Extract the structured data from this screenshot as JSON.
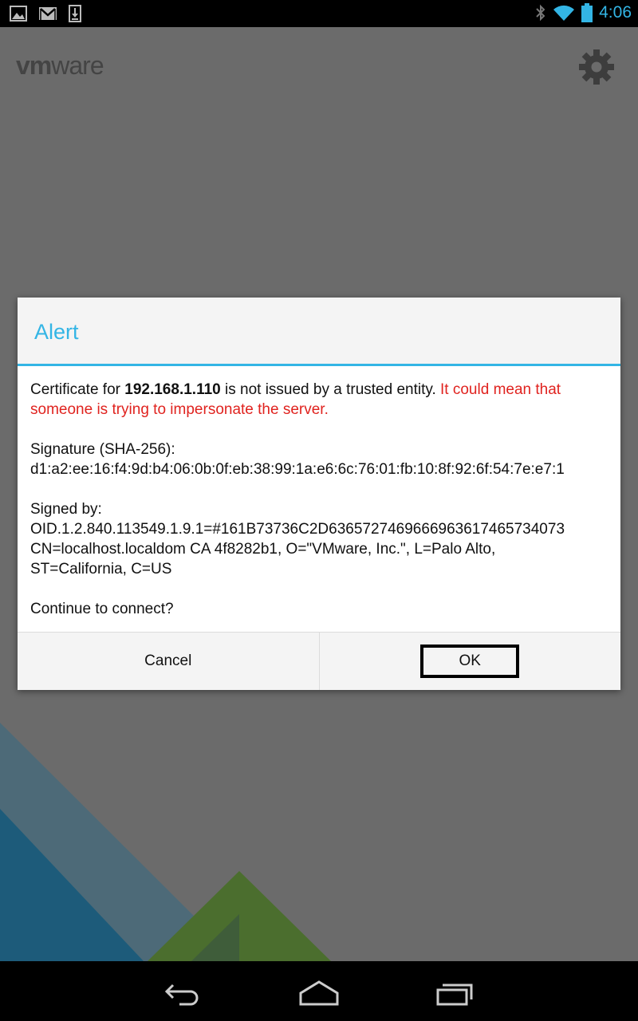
{
  "status_bar": {
    "time": "4:06",
    "left_icons": [
      "image-icon",
      "gmail-icon",
      "download-icon"
    ],
    "right_icons": [
      "bluetooth-icon",
      "wifi-icon",
      "battery-icon"
    ],
    "accent_color": "#33b5e5"
  },
  "app": {
    "brand_vm": "vm",
    "brand_ware": "ware",
    "settings_icon": "gear-icon"
  },
  "dialog": {
    "title": "Alert",
    "cert_prefix": "Certificate for ",
    "cert_host": "192.168.1.110",
    "cert_suffix": " is not issued by a trusted entity. ",
    "cert_warning": "It could mean that someone is trying to impersonate the server.",
    "signature_label": "Signature (SHA-256):",
    "signature_value": "d1:a2:ee:16:f4:9d:b4:06:0b:0f:eb:38:99:1a:e6:6c:76:01:fb:10:8f:92:6f:54:7e:e7:1",
    "signed_by_label": "Signed by:",
    "signed_by_oid": "OID.1.2.840.113549.1.9.1=#161B73736C2D6365727469666963617465734073",
    "signed_by_cn": "CN=localhost.localdom CA 4f8282b1, O=\"VMware, Inc.\", L=Palo Alto,",
    "signed_by_st": "ST=California, C=US",
    "question": "Continue to connect?",
    "cancel_label": "Cancel",
    "ok_label": "OK",
    "warning_color": "#e0231f"
  },
  "nav_bar": {
    "icons": [
      "back-icon",
      "home-icon",
      "recents-icon"
    ]
  }
}
